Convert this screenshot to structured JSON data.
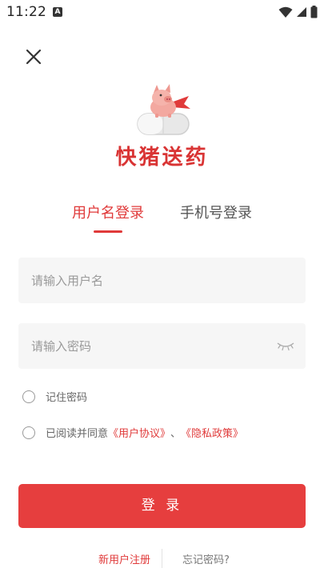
{
  "status_bar": {
    "time": "11:22",
    "notification_icon": "a-badge-icon",
    "icons": [
      "wifi-icon",
      "signal-icon",
      "battery-icon"
    ]
  },
  "header": {
    "close_icon": "close-icon"
  },
  "brand": {
    "name": "快猪送药",
    "logo_icon": "pig-on-pill-logo",
    "accent_color": "#e03a3a"
  },
  "tabs": [
    {
      "label": "用户名登录",
      "active": true
    },
    {
      "label": "手机号登录",
      "active": false
    }
  ],
  "form": {
    "username_placeholder": "请输入用户名",
    "username_value": "",
    "password_placeholder": "请输入密码",
    "password_value": "",
    "password_toggle_icon": "eye-closed-icon"
  },
  "remember": {
    "label": "记住密码",
    "checked": false
  },
  "agreement": {
    "checked": false,
    "prefix": "已阅读并同意",
    "user_agreement": "《用户协议》",
    "separator": "、",
    "privacy_policy": "《隐私政策》"
  },
  "login_button": {
    "label": "登 录"
  },
  "footer": {
    "register": "新用户注册",
    "forgot": "忘记密码?"
  }
}
